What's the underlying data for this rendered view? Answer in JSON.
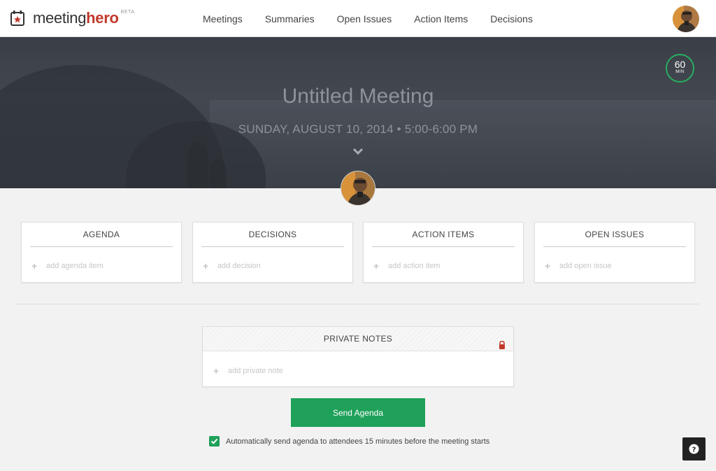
{
  "brand": {
    "name_prefix": "meeting",
    "name_suffix": "hero",
    "badge": "BETA"
  },
  "nav": {
    "items": [
      "Meetings",
      "Summaries",
      "Open Issues",
      "Action Items",
      "Decisions"
    ]
  },
  "meeting": {
    "title": "Untitled Meeting",
    "datetime": "SUNDAY, AUGUST 10, 2014 • 5:00-6:00 PM",
    "duration_value": "60",
    "duration_unit": "MIN"
  },
  "cards": [
    {
      "title": "AGENDA",
      "add_label": "add agenda item"
    },
    {
      "title": "DECISIONS",
      "add_label": "add decision"
    },
    {
      "title": "ACTION ITEMS",
      "add_label": "add action item"
    },
    {
      "title": "OPEN ISSUES",
      "add_label": "add open issue"
    }
  ],
  "private_notes": {
    "title": "PRIVATE NOTES",
    "add_label": "add private note"
  },
  "send_button": {
    "label": "Send Agenda"
  },
  "auto_send": {
    "checked": true,
    "label": "Automatically send agenda to attendees 15 minutes before the meeting starts"
  },
  "colors": {
    "brand_red": "#c0392b",
    "accent_green": "#1fa15a",
    "banner": "#3a3f47"
  }
}
